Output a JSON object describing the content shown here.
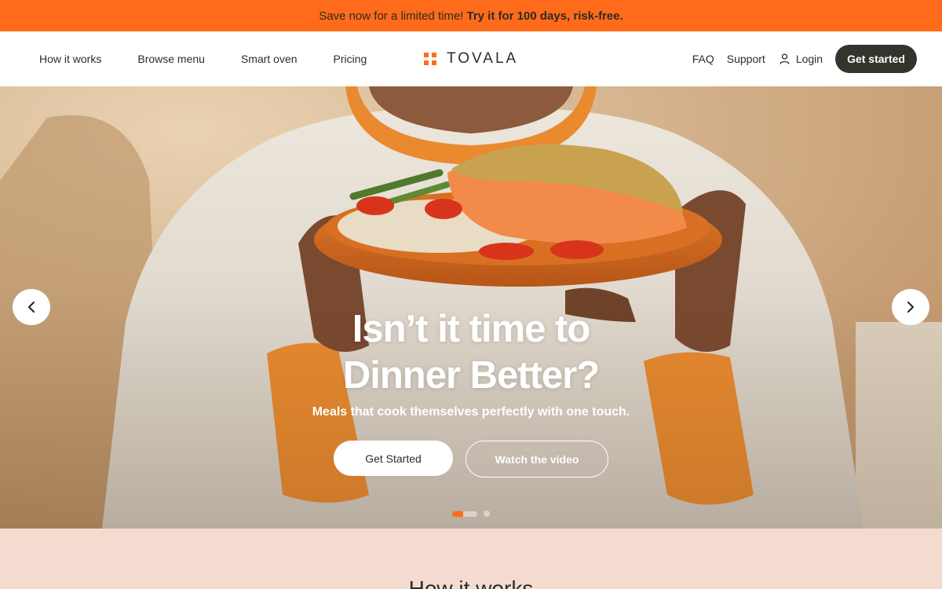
{
  "promo": {
    "text": "Save now for a limited time!",
    "link": "Try it for 100 days, risk-free."
  },
  "nav": {
    "links": [
      "How it works",
      "Browse menu",
      "Smart oven",
      "Pricing"
    ],
    "brand": "TOVALA",
    "faq": "FAQ",
    "support": "Support",
    "login": "Login",
    "cta": "Get started"
  },
  "hero": {
    "headline_line1": "Isn’t it time to",
    "headline_line2": "Dinner Better?",
    "subline": "Meals that cook themselves perfectly with one touch.",
    "primary_button": "Get Started",
    "secondary_button": "Watch the video",
    "slide_count": 2,
    "active_slide": 1
  },
  "section": {
    "title": "How it works"
  },
  "colors": {
    "accent": "#ff6b1a",
    "dark": "#34342d",
    "peach": "#f3dccf"
  },
  "icons": [
    "user-icon",
    "chevron-left-icon",
    "chevron-right-icon",
    "tovala-logo-icon"
  ]
}
